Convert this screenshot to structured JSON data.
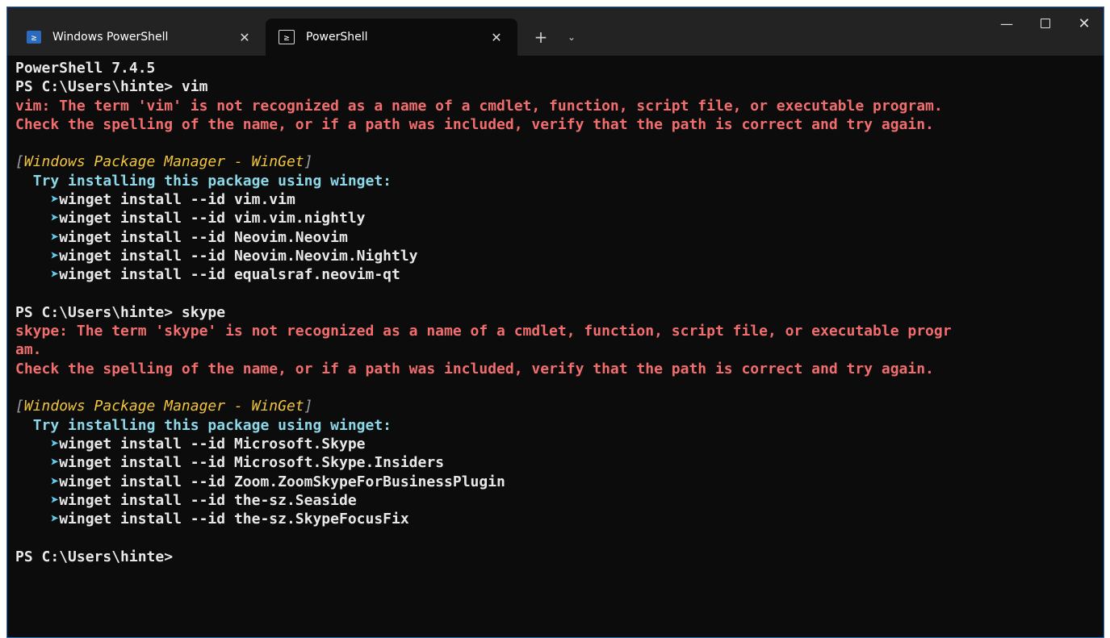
{
  "tabs": [
    {
      "title": "Windows PowerShell",
      "active": false
    },
    {
      "title": "PowerShell",
      "active": true
    }
  ],
  "tabbar": {
    "new_tab": "+",
    "dropdown": "⌄",
    "close_glyph": "✕",
    "ps_glyph": "≥"
  },
  "window_controls": {
    "minimize": "—",
    "close": "✕"
  },
  "colors": {
    "error": "#f26d6d",
    "header": "#f1c43c",
    "hint": "#8ad8e8",
    "background": "#0c0c0c"
  },
  "terminal": {
    "version": "PowerShell 7.4.5",
    "prompt1": "PS C:\\Users\\hinte> vim",
    "err1_line1": "vim: The term 'vim' is not recognized as a name of a cmdlet, function, script file, or executable program.",
    "err1_line2": "Check the spelling of the name, or if a path was included, verify that the path is correct and try again.",
    "winget_header": "Windows Package Manager - WinGet",
    "try_line": "Try installing this package using winget:",
    "arrow": "➤",
    "suggestions1": [
      "winget install --id vim.vim",
      "winget install --id vim.vim.nightly",
      "winget install --id Neovim.Neovim",
      "winget install --id Neovim.Neovim.Nightly",
      "winget install --id equalsraf.neovim-qt"
    ],
    "prompt2": "PS C:\\Users\\hinte> skype",
    "err2_line1": "skype: The term 'skype' is not recognized as a name of a cmdlet, function, script file, or executable progr",
    "err2_line1b": "am.",
    "err2_line2": "Check the spelling of the name, or if a path was included, verify that the path is correct and try again.",
    "suggestions2": [
      "winget install --id Microsoft.Skype",
      "winget install --id Microsoft.Skype.Insiders",
      "winget install --id Zoom.ZoomSkypeForBusinessPlugin",
      "winget install --id the-sz.Seaside",
      "winget install --id the-sz.SkypeFocusFix"
    ],
    "prompt3": "PS C:\\Users\\hinte>"
  }
}
